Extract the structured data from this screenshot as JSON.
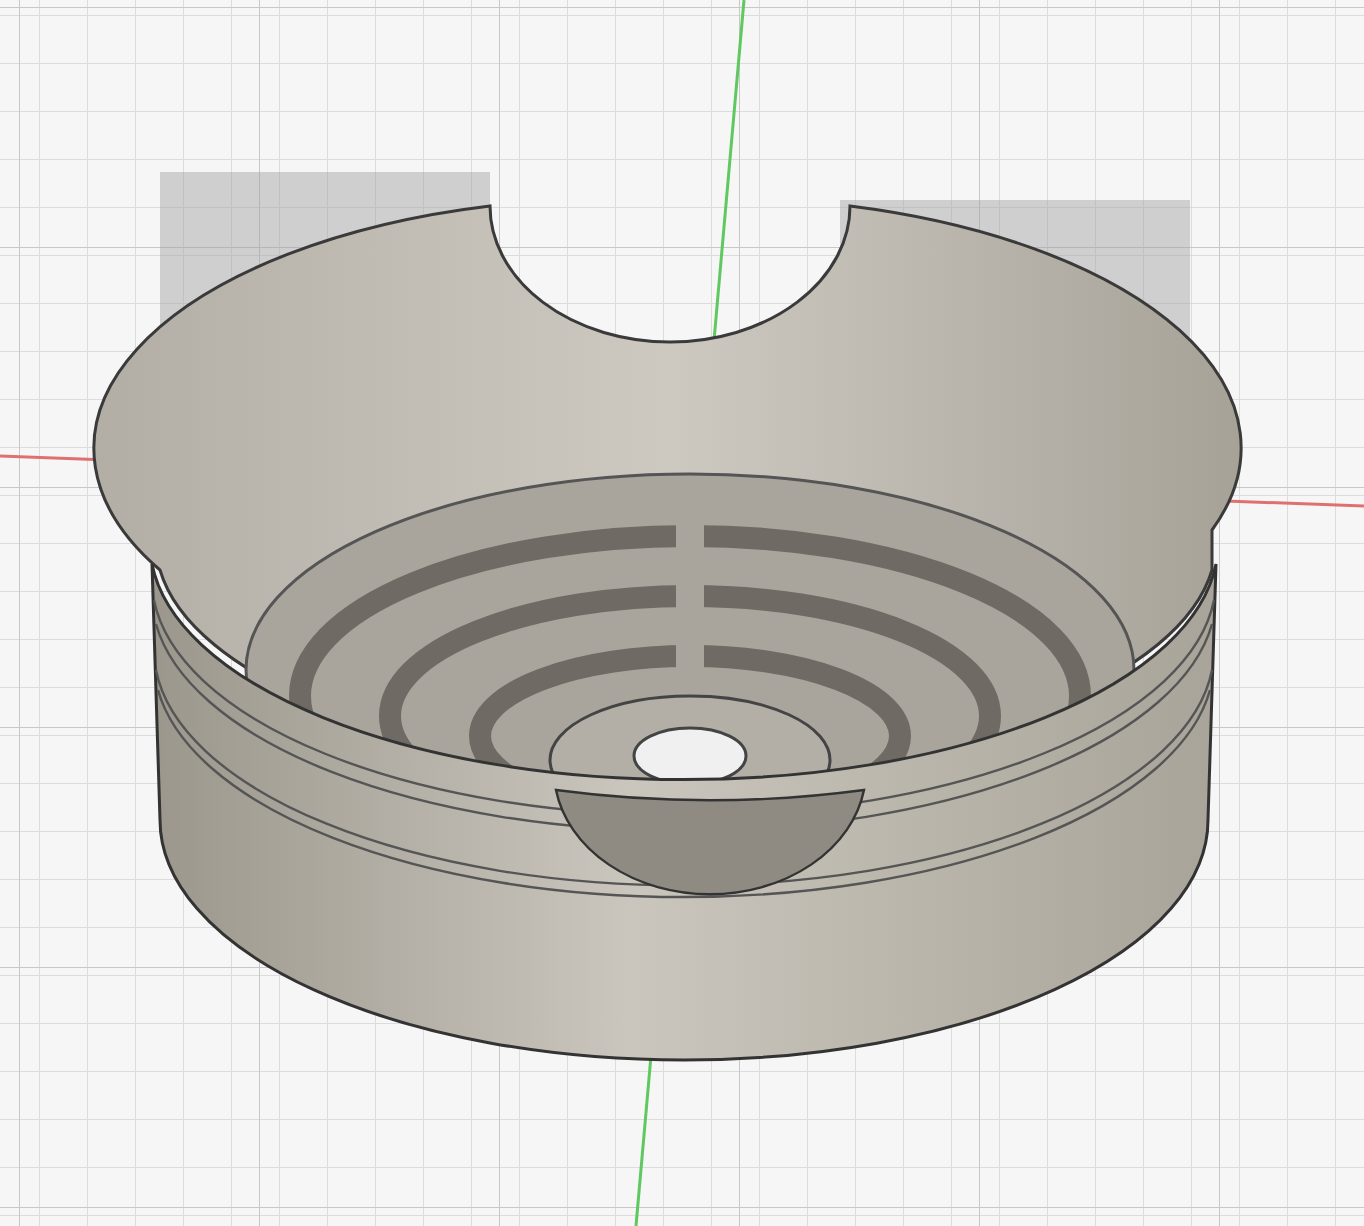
{
  "viewport": {
    "axes": [
      {
        "kind": "x",
        "color": "#e07070"
      },
      {
        "kind": "y",
        "color": "#60c860"
      }
    ]
  }
}
